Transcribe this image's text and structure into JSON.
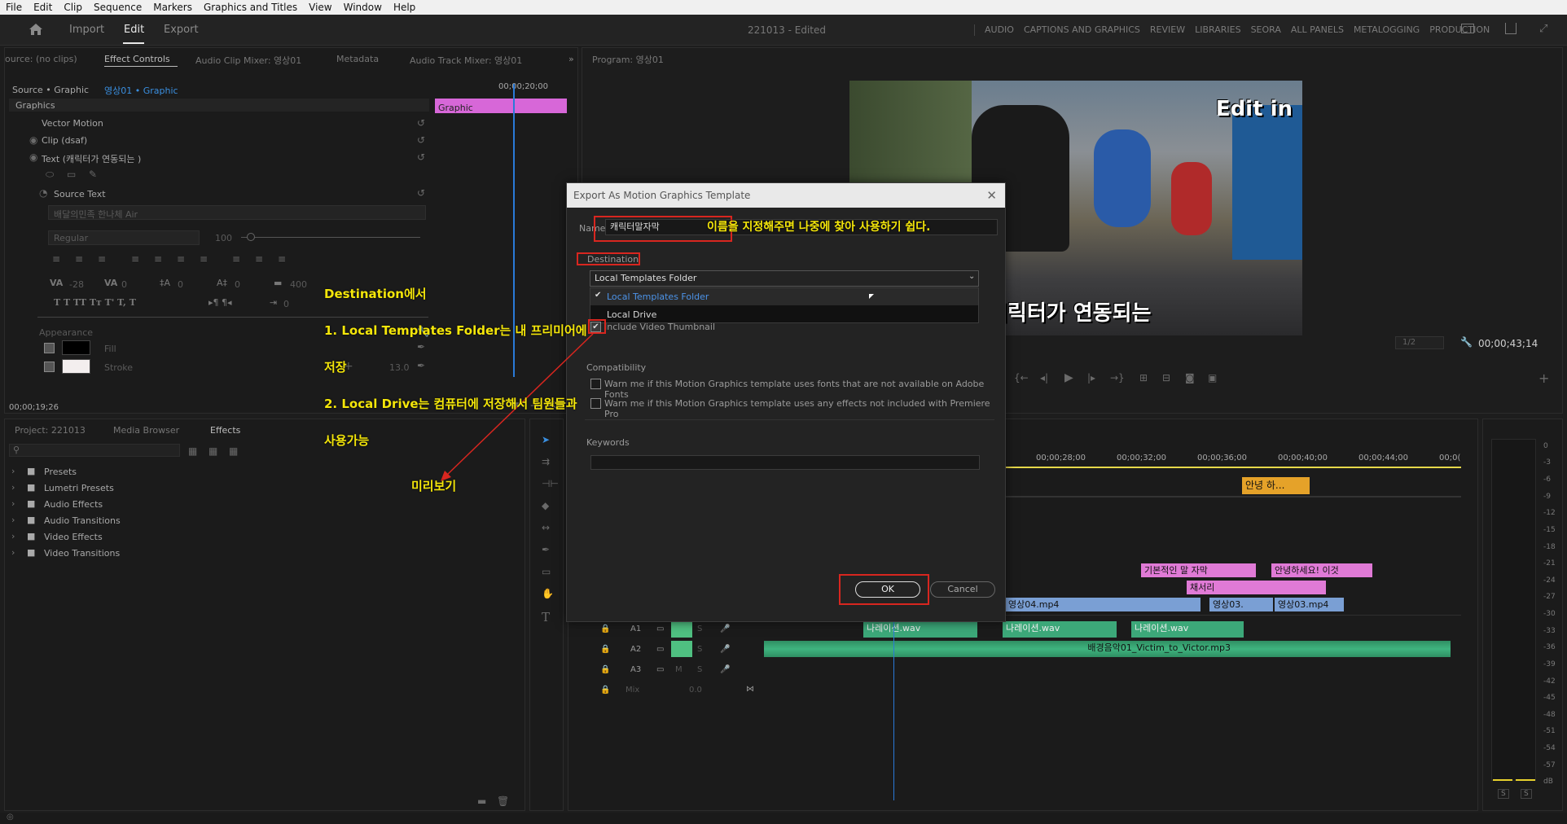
{
  "menu": [
    "File",
    "Edit",
    "Clip",
    "Sequence",
    "Markers",
    "Graphics and Titles",
    "View",
    "Window",
    "Help"
  ],
  "workspace": {
    "tabs": [
      "Import",
      "Edit",
      "Export"
    ],
    "active": "Edit",
    "project_title": "221013 - Edited",
    "links": [
      "AUDIO",
      "CAPTIONS AND GRAPHICS",
      "REVIEW",
      "LIBRARIES",
      "SEORA",
      "ALL PANELS",
      "METALOGGING",
      "PRODUCTION"
    ]
  },
  "effect_controls": {
    "tabs": [
      "ource: (no clips)",
      "Effect Controls",
      "Audio Clip Mixer: 영상01",
      "Metadata",
      "Audio Track Mixer: 영상01"
    ],
    "source_label": "Source • Graphic",
    "sequence_label": "영상01 • Graphic",
    "timecode_ruler": "00;00;20;00",
    "clip_label": "Graphic",
    "section": "Graphics",
    "items": [
      "Vector Motion",
      "Clip (dsaf)",
      "Text (캐릭터가 연동되는 )"
    ],
    "source_text": "Source Text",
    "font": "배달의민족 한나체 Air",
    "font_style": "Regular",
    "font_size": "100",
    "tracking_values": [
      "-28",
      "0",
      "0",
      "0",
      "400",
      "0"
    ],
    "appearance": "Appearance",
    "fill": "Fill",
    "stroke": "Stroke",
    "stroke_value": "13.0",
    "current_time": "00;00;19;26"
  },
  "program": {
    "tab": "Program: 영상01",
    "overlay_top": "Edit in",
    "overlay_caption": "캐릭터가 연동되는",
    "zoom": "1/2",
    "timecode": "00;00;43;14"
  },
  "project_panel": {
    "tabs": [
      "Project: 221013",
      "Media Browser",
      "Effects"
    ],
    "items": [
      "Presets",
      "Lumetri Presets",
      "Audio Effects",
      "Audio Transitions",
      "Video Effects",
      "Video Transitions"
    ]
  },
  "timeline": {
    "ruler": [
      "00;00;28;00",
      "00;00;32;00",
      "00;00;36;00",
      "00;00;40;00",
      "00;00;44;00",
      "00;0("
    ],
    "tracks": [
      "A1",
      "A2",
      "A3",
      "Mix"
    ],
    "mix_value": "0.0",
    "clips": {
      "caption": "안녕 하...",
      "g1": "기본적인 말 자막",
      "g2": "안녕하세요! 이것",
      "g3": "채서리",
      "v1": "영상04.mp4",
      "v2": "영상03.",
      "v3": "영상03.mp4",
      "a1": "나레이션.wav",
      "a2": "나레이션.wav",
      "a3": "나레이션.wav",
      "music": "배경음악01_Victim_to_Victor.mp3"
    }
  },
  "meter_scale": [
    "0",
    "-3",
    "-6",
    "-9",
    "-12",
    "-15",
    "-18",
    "-21",
    "-24",
    "-27",
    "-30",
    "-33",
    "-36",
    "-39",
    "-42",
    "-45",
    "-48",
    "-51",
    "-54",
    "-57",
    "dB"
  ],
  "meter_buttons": [
    "S",
    "S"
  ],
  "dialog": {
    "title": "Export As Motion Graphics Template",
    "name_label": "Name:",
    "name_value": "캐릭터말자막",
    "destination_label": "Destination",
    "destination_value": "Local Templates Folder",
    "dropdown_options": [
      "Local Templates Folder",
      "Local Drive"
    ],
    "include_thumbnail": "Include Video Thumbnail",
    "compatibility_label": "Compatibility",
    "warn1": "Warn me if this Motion Graphics template uses fonts that are not available on Adobe Fonts",
    "warn2": "Warn me if this Motion Graphics template uses any effects not included with Premiere Pro",
    "keywords_label": "Keywords",
    "ok": "OK",
    "cancel": "Cancel"
  },
  "annotations": {
    "name_tip": "이름을 지정해주면 나중에 찾아 사용하기 쉽다.",
    "destination_tip_1": "Destination에서",
    "destination_tip_2": "1. Local Templates Folder는 내 프리미어에",
    "destination_tip_3": "저장",
    "destination_tip_4": "2. Local Drive는 컴퓨터에 저장해서 팀원들과",
    "destination_tip_5": "사용가능",
    "preview_tip": "미리보기"
  }
}
